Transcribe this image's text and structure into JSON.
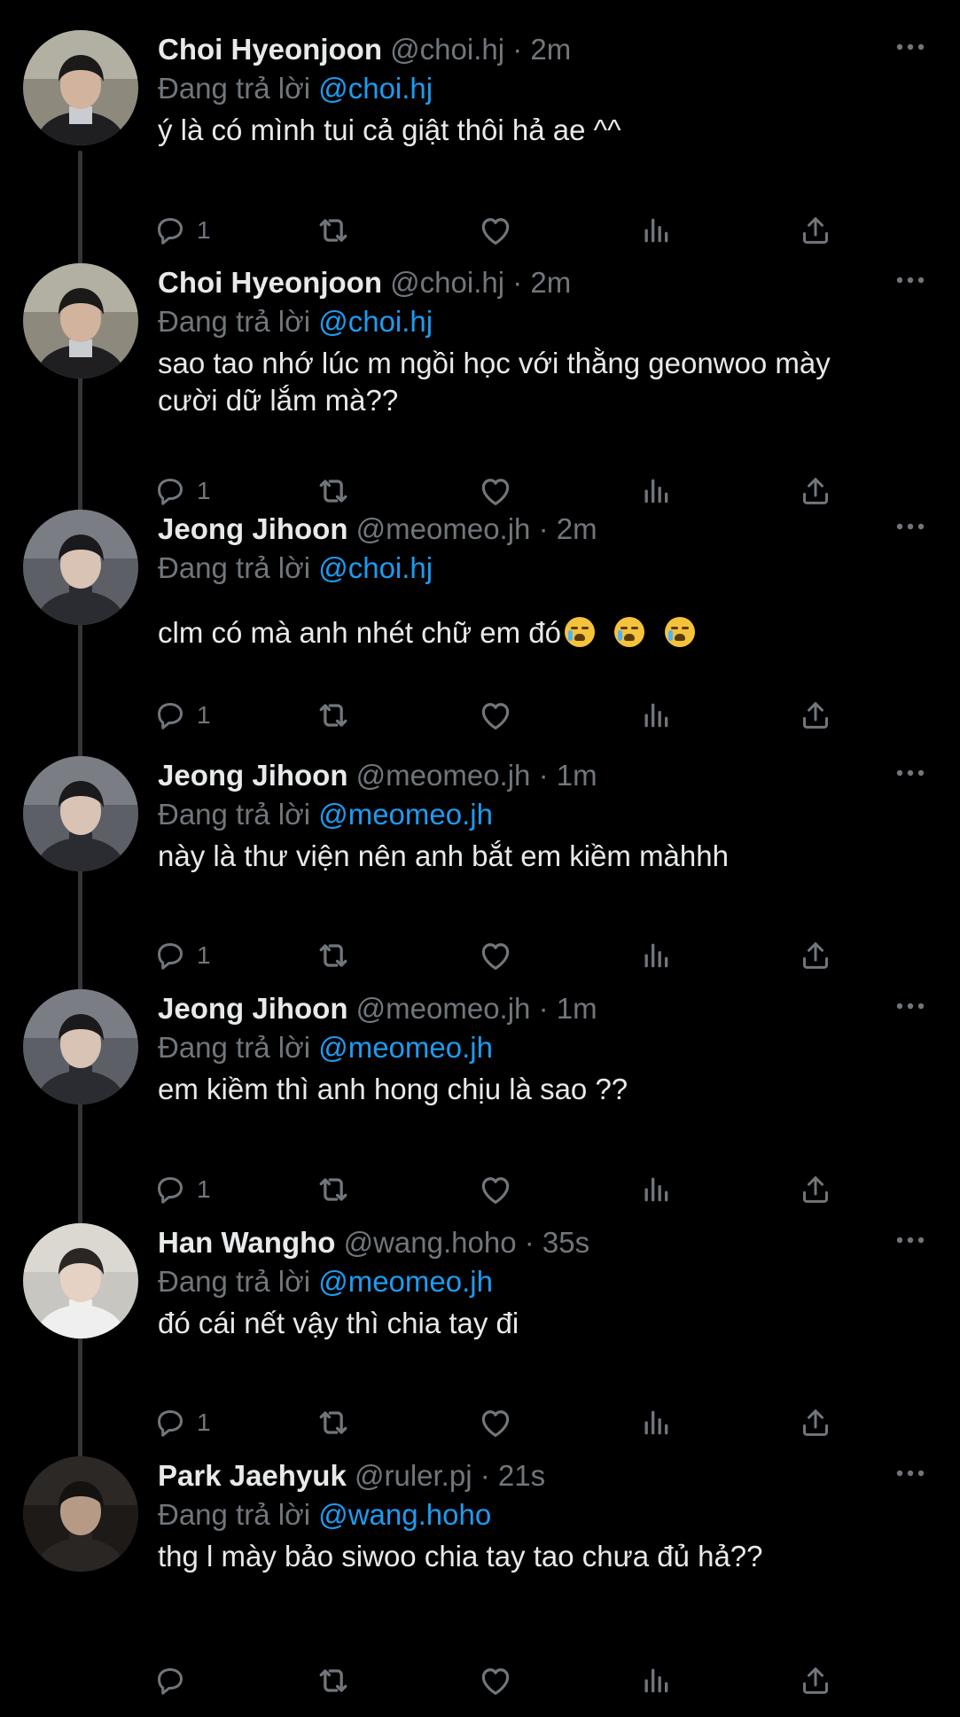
{
  "reply_prefix": "Đang trả lời",
  "tweets": [
    {
      "name": "Choi Hyeonjoon",
      "handle": "@choi.hj",
      "time": "2m",
      "reply_to": "@choi.hj",
      "text_lines": [
        "ý là có mình tui cả giật thôi hả ae ^^"
      ],
      "reply_count": "1",
      "avatar": "avatar-choi-hyeonjoon"
    },
    {
      "name": "Choi Hyeonjoon",
      "handle": "@choi.hj",
      "time": "2m",
      "reply_to": "@choi.hj",
      "text_lines": [
        "sao tao nhớ lúc m ngồi học với thằng geonwoo mày",
        "cười dữ lắm mà??"
      ],
      "reply_count": "1",
      "avatar": "avatar-choi-hyeonjoon"
    },
    {
      "name": "Jeong Jihoon",
      "handle": "@meomeo.jh",
      "time": "2m",
      "reply_to": "@choi.hj",
      "text_lines": [
        "clm có mà anh nhét chữ em đó"
      ],
      "emoji": [
        "loudly-crying-face",
        "loudly-crying-face",
        "loudly-crying-face"
      ],
      "reply_count": "1",
      "avatar": "avatar-jeong-jihoon"
    },
    {
      "name": "Jeong Jihoon",
      "handle": "@meomeo.jh",
      "time": "1m",
      "reply_to": "@meomeo.jh",
      "text_lines": [
        "này là thư viện nên anh bắt em kiềm màhhh"
      ],
      "reply_count": "1",
      "avatar": "avatar-jeong-jihoon"
    },
    {
      "name": "Jeong Jihoon",
      "handle": "@meomeo.jh",
      "time": "1m",
      "reply_to": "@meomeo.jh",
      "text_lines": [
        "em kiềm thì anh hong chịu là sao ??"
      ],
      "reply_count": "1",
      "avatar": "avatar-jeong-jihoon"
    },
    {
      "name": "Han Wangho",
      "handle": "@wang.hoho",
      "time": "35s",
      "reply_to": "@meomeo.jh",
      "text_lines": [
        "đó cái nết vậy thì chia tay đi"
      ],
      "reply_count": "1",
      "avatar": "avatar-han-wangho"
    },
    {
      "name": "Park Jaehyuk",
      "handle": "@ruler.pj",
      "time": "21s",
      "reply_to": "@wang.hoho",
      "text_lines": [
        "thg l mày bảo siwoo chia tay tao chưa đủ hả??"
      ],
      "reply_count": "",
      "avatar": "avatar-park-jaehyuk"
    }
  ],
  "colors": {
    "background": "#000000",
    "text": "#e7e9ea",
    "muted": "#71767b",
    "link": "#1d9bf0",
    "thread_line": "#333639"
  },
  "icons": [
    "reply-icon",
    "retweet-icon",
    "like-icon",
    "views-icon",
    "share-icon",
    "more-icon"
  ]
}
